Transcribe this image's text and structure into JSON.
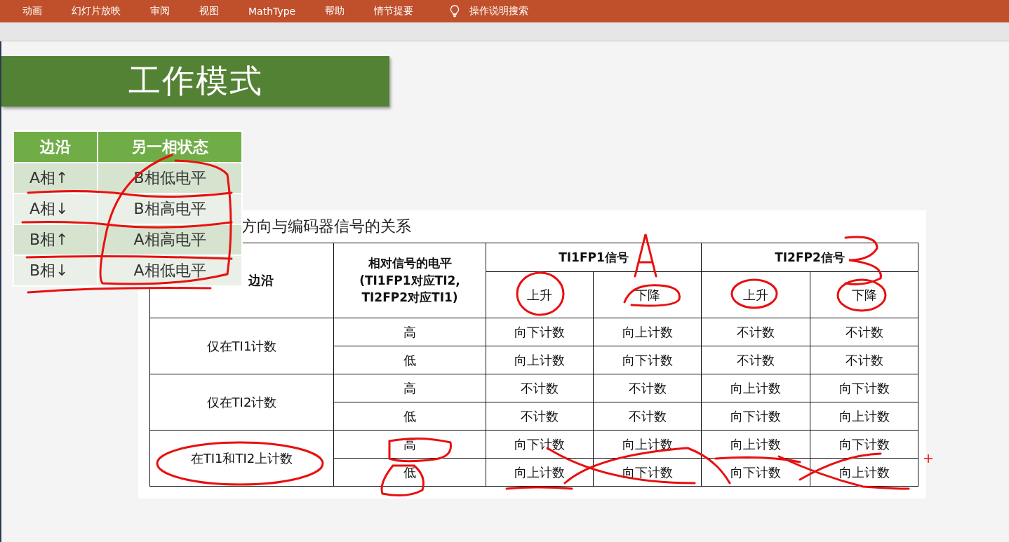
{
  "ribbon": {
    "tabs": [
      {
        "label": "动画"
      },
      {
        "label": "幻灯片放映"
      },
      {
        "label": "审阅"
      },
      {
        "label": "视图"
      },
      {
        "label": "MathType"
      },
      {
        "label": "帮助"
      },
      {
        "label": "情节提要"
      }
    ],
    "search": {
      "label": "操作说明搜索"
    }
  },
  "slide": {
    "title": "工作模式",
    "edge_table": {
      "columns": [
        "边沿",
        "另一相状态"
      ],
      "rows": [
        {
          "edge": "A相↑",
          "state": "B相低电平"
        },
        {
          "edge": "A相↓",
          "state": "B相高电平"
        },
        {
          "edge": "B相↑",
          "state": "A相高电平"
        },
        {
          "edge": "B相↓",
          "state": "A相低电平"
        }
      ]
    },
    "count_table": {
      "caption": "方向与编码器信号的关系",
      "edge_header": "边沿",
      "level_header": [
        "相对信号的电平",
        "(TI1FP1对应TI2,",
        "TI2FP2对应TI1)"
      ],
      "signal_headers": [
        "TI1FP1信号",
        "TI2FP2信号"
      ],
      "sub_headers": [
        "上升",
        "下降",
        "上升",
        "下降"
      ],
      "groups": [
        {
          "mode": "仅在TI1计数",
          "rows": [
            {
              "level": "高",
              "values": [
                "向下计数",
                "向上计数",
                "不计数",
                "不计数"
              ]
            },
            {
              "level": "低",
              "values": [
                "向上计数",
                "向下计数",
                "不计数",
                "不计数"
              ]
            }
          ]
        },
        {
          "mode": "仅在TI2计数",
          "rows": [
            {
              "level": "高",
              "values": [
                "不计数",
                "不计数",
                "向上计数",
                "向下计数"
              ]
            },
            {
              "level": "低",
              "values": [
                "不计数",
                "不计数",
                "向下计数",
                "向上计数"
              ]
            }
          ]
        },
        {
          "mode": "在TI1和TI2上计数",
          "rows": [
            {
              "level": "高",
              "values": [
                "向下计数",
                "向上计数",
                "向上计数",
                "向下计数"
              ]
            },
            {
              "level": "低",
              "values": [
                "向上计数",
                "向下计数",
                "向下计数",
                "向上计数"
              ]
            }
          ]
        }
      ]
    }
  }
}
